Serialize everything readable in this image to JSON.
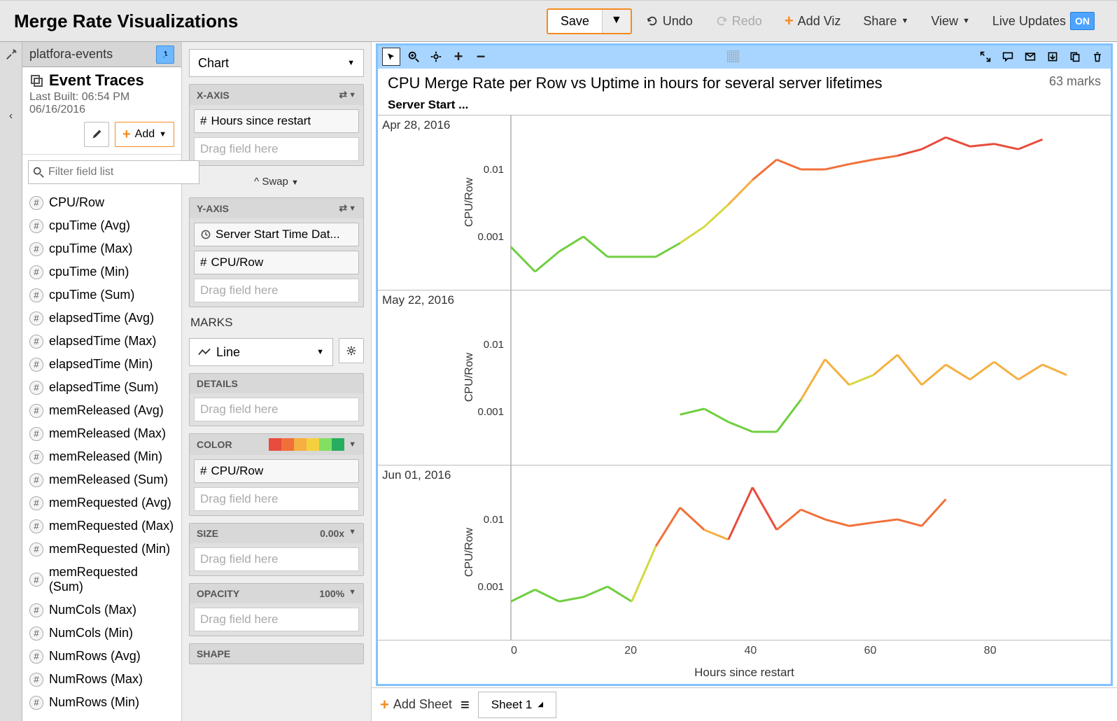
{
  "topbar": {
    "title": "Merge Rate Visualizations",
    "save": "Save",
    "undo": "Undo",
    "redo": "Redo",
    "addviz": "Add Viz",
    "share": "Share",
    "view": "View",
    "live": "Live Updates",
    "live_state": "ON"
  },
  "projectbar": {
    "name": "platfora-events"
  },
  "lens": {
    "name": "Event Traces",
    "lastbuilt": "Last Built: 06:54 PM 06/16/2016",
    "add": "Add"
  },
  "filter": {
    "placeholder": "Filter field list"
  },
  "fields": [
    "CPU/Row",
    "cpuTime (Avg)",
    "cpuTime (Max)",
    "cpuTime (Min)",
    "cpuTime (Sum)",
    "elapsedTime (Avg)",
    "elapsedTime (Max)",
    "elapsedTime (Min)",
    "elapsedTime (Sum)",
    "memReleased (Avg)",
    "memReleased (Max)",
    "memReleased (Min)",
    "memReleased (Sum)",
    "memRequested (Avg)",
    "memRequested (Max)",
    "memRequested (Min)",
    "memRequested (Sum)",
    "NumCols (Max)",
    "NumCols (Min)",
    "NumRows (Avg)",
    "NumRows (Max)",
    "NumRows (Min)"
  ],
  "builder": {
    "chart": "Chart",
    "xaxis": "X-AXIS",
    "x_field": "Hours since restart",
    "x_drop": "Drag field here",
    "swap": "Swap",
    "yaxis": "Y-AXIS",
    "y_field1": "Server Start Time Dat...",
    "y_field2": "CPU/Row",
    "y_drop": "Drag field here",
    "marks": "MARKS",
    "mark_type": "Line",
    "details": "DETAILS",
    "details_drop": "Drag field here",
    "color": "COLOR",
    "color_field": "CPU/Row",
    "color_drop": "Drag field here",
    "size": "SIZE",
    "size_val": "0.00x",
    "size_drop": "Drag field here",
    "opacity": "OPACITY",
    "opacity_val": "100%",
    "opacity_drop": "Drag field here",
    "shape": "SHAPE"
  },
  "viz": {
    "title": "CPU Merge Rate per Row vs Uptime in hours for several server lifetimes",
    "marks": "63 marks",
    "sub": "Server Start ...",
    "ylabel": "CPU/Row",
    "xlabel": "Hours since restart",
    "panels": [
      "Apr 28, 2016",
      "May 22, 2016",
      "Jun 01, 2016"
    ],
    "yticks": [
      "0.01",
      "0.001"
    ]
  },
  "sheets": {
    "add": "Add Sheet",
    "tab1": "Sheet 1"
  },
  "chart_data": [
    {
      "type": "line",
      "panel": "Apr 28, 2016",
      "xlabel": "Hours since restart",
      "ylabel": "CPU/Row",
      "ylim": [
        0.0001,
        0.1
      ],
      "yscale": "log",
      "x": [
        0,
        4,
        8,
        12,
        16,
        20,
        24,
        28,
        32,
        36,
        40,
        44,
        48,
        52,
        56,
        60,
        64,
        68,
        72,
        76,
        80,
        84,
        88
      ],
      "y": [
        0.0007,
        0.0003,
        0.0006,
        0.001,
        0.0005,
        0.0005,
        0.0005,
        0.0008,
        0.0014,
        0.003,
        0.007,
        0.014,
        0.01,
        0.01,
        0.012,
        0.014,
        0.016,
        0.02,
        0.03,
        0.022,
        0.024,
        0.02,
        0.028
      ]
    },
    {
      "type": "line",
      "panel": "May 22, 2016",
      "xlabel": "Hours since restart",
      "ylabel": "CPU/Row",
      "ylim": [
        0.0001,
        0.1
      ],
      "yscale": "log",
      "x": [
        28,
        32,
        36,
        40,
        44,
        48,
        52,
        56,
        60,
        64,
        68,
        72,
        76,
        80,
        84,
        88,
        92
      ],
      "y": [
        0.0009,
        0.0011,
        0.0007,
        0.0005,
        0.0005,
        0.0015,
        0.006,
        0.0025,
        0.0035,
        0.007,
        0.0025,
        0.005,
        0.003,
        0.0055,
        0.003,
        0.005,
        0.0035
      ]
    },
    {
      "type": "line",
      "panel": "Jun 01, 2016",
      "xlabel": "Hours since restart",
      "ylabel": "CPU/Row",
      "ylim": [
        0.0001,
        0.1
      ],
      "yscale": "log",
      "x": [
        0,
        4,
        8,
        12,
        16,
        20,
        24,
        28,
        32,
        36,
        40,
        44,
        48,
        52,
        56,
        60,
        64,
        68,
        72
      ],
      "y": [
        0.0006,
        0.0009,
        0.0006,
        0.0007,
        0.001,
        0.0006,
        0.004,
        0.015,
        0.007,
        0.005,
        0.03,
        0.007,
        0.014,
        0.01,
        0.008,
        0.009,
        0.01,
        0.008,
        0.02
      ]
    }
  ]
}
